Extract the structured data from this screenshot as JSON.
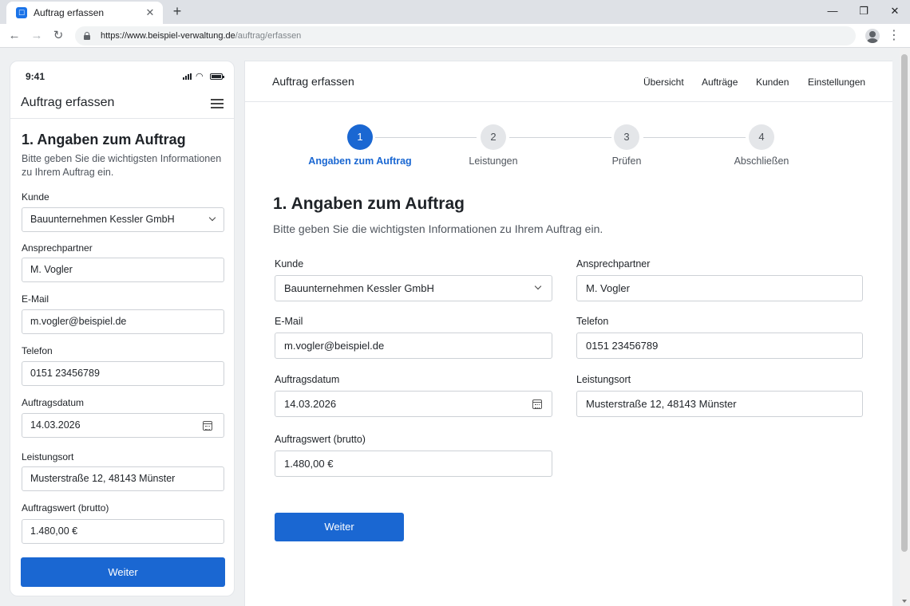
{
  "browser": {
    "tab_title": "Auftrag erfassen",
    "url_host": "https://www.beispiel-verwaltung.de",
    "url_path": "/auftrag/erfassen"
  },
  "mobile": {
    "time": "9:41",
    "appbar_title": "Auftrag erfassen",
    "heading": "1. Angaben zum Auftrag",
    "intro": "Bitte geben Sie die wichtigsten Informationen zu Ihrem Auftrag ein.",
    "next_label": "Weiter"
  },
  "desktop": {
    "header_title": "Auftrag erfassen",
    "nav": [
      "Übersicht",
      "Aufträge",
      "Kunden",
      "Einstellungen"
    ],
    "steps": [
      {
        "number": "1",
        "label": "Angaben zum Auftrag",
        "active": true
      },
      {
        "number": "2",
        "label": "Leistungen",
        "active": false
      },
      {
        "number": "3",
        "label": "Prüfen",
        "active": false
      },
      {
        "number": "4",
        "label": "Abschließen",
        "active": false
      }
    ],
    "heading": "1. Angaben zum Auftrag",
    "intro": "Bitte geben Sie die wichtigsten Informationen zu Ihrem Auftrag ein.",
    "next_label": "Weiter"
  },
  "form": {
    "kunde": {
      "label": "Kunde",
      "value": "Bauunternehmen Kessler GmbH"
    },
    "ansprechpartner": {
      "label": "Ansprechpartner",
      "value": "M. Vogler"
    },
    "email": {
      "label": "E-Mail",
      "value": "m.vogler@beispiel.de"
    },
    "telefon": {
      "label": "Telefon",
      "value": "0151 23456789"
    },
    "auftragsdatum": {
      "label": "Auftragsdatum",
      "value": "14.03.2026"
    },
    "leistungsort": {
      "label": "Leistungsort",
      "value": "Musterstraße 12, 48143 Münster"
    },
    "auftragswert": {
      "label": "Auftragswert (brutto)",
      "value": "1.480,00 €"
    }
  },
  "colors": {
    "accent": "#1a67d2"
  }
}
